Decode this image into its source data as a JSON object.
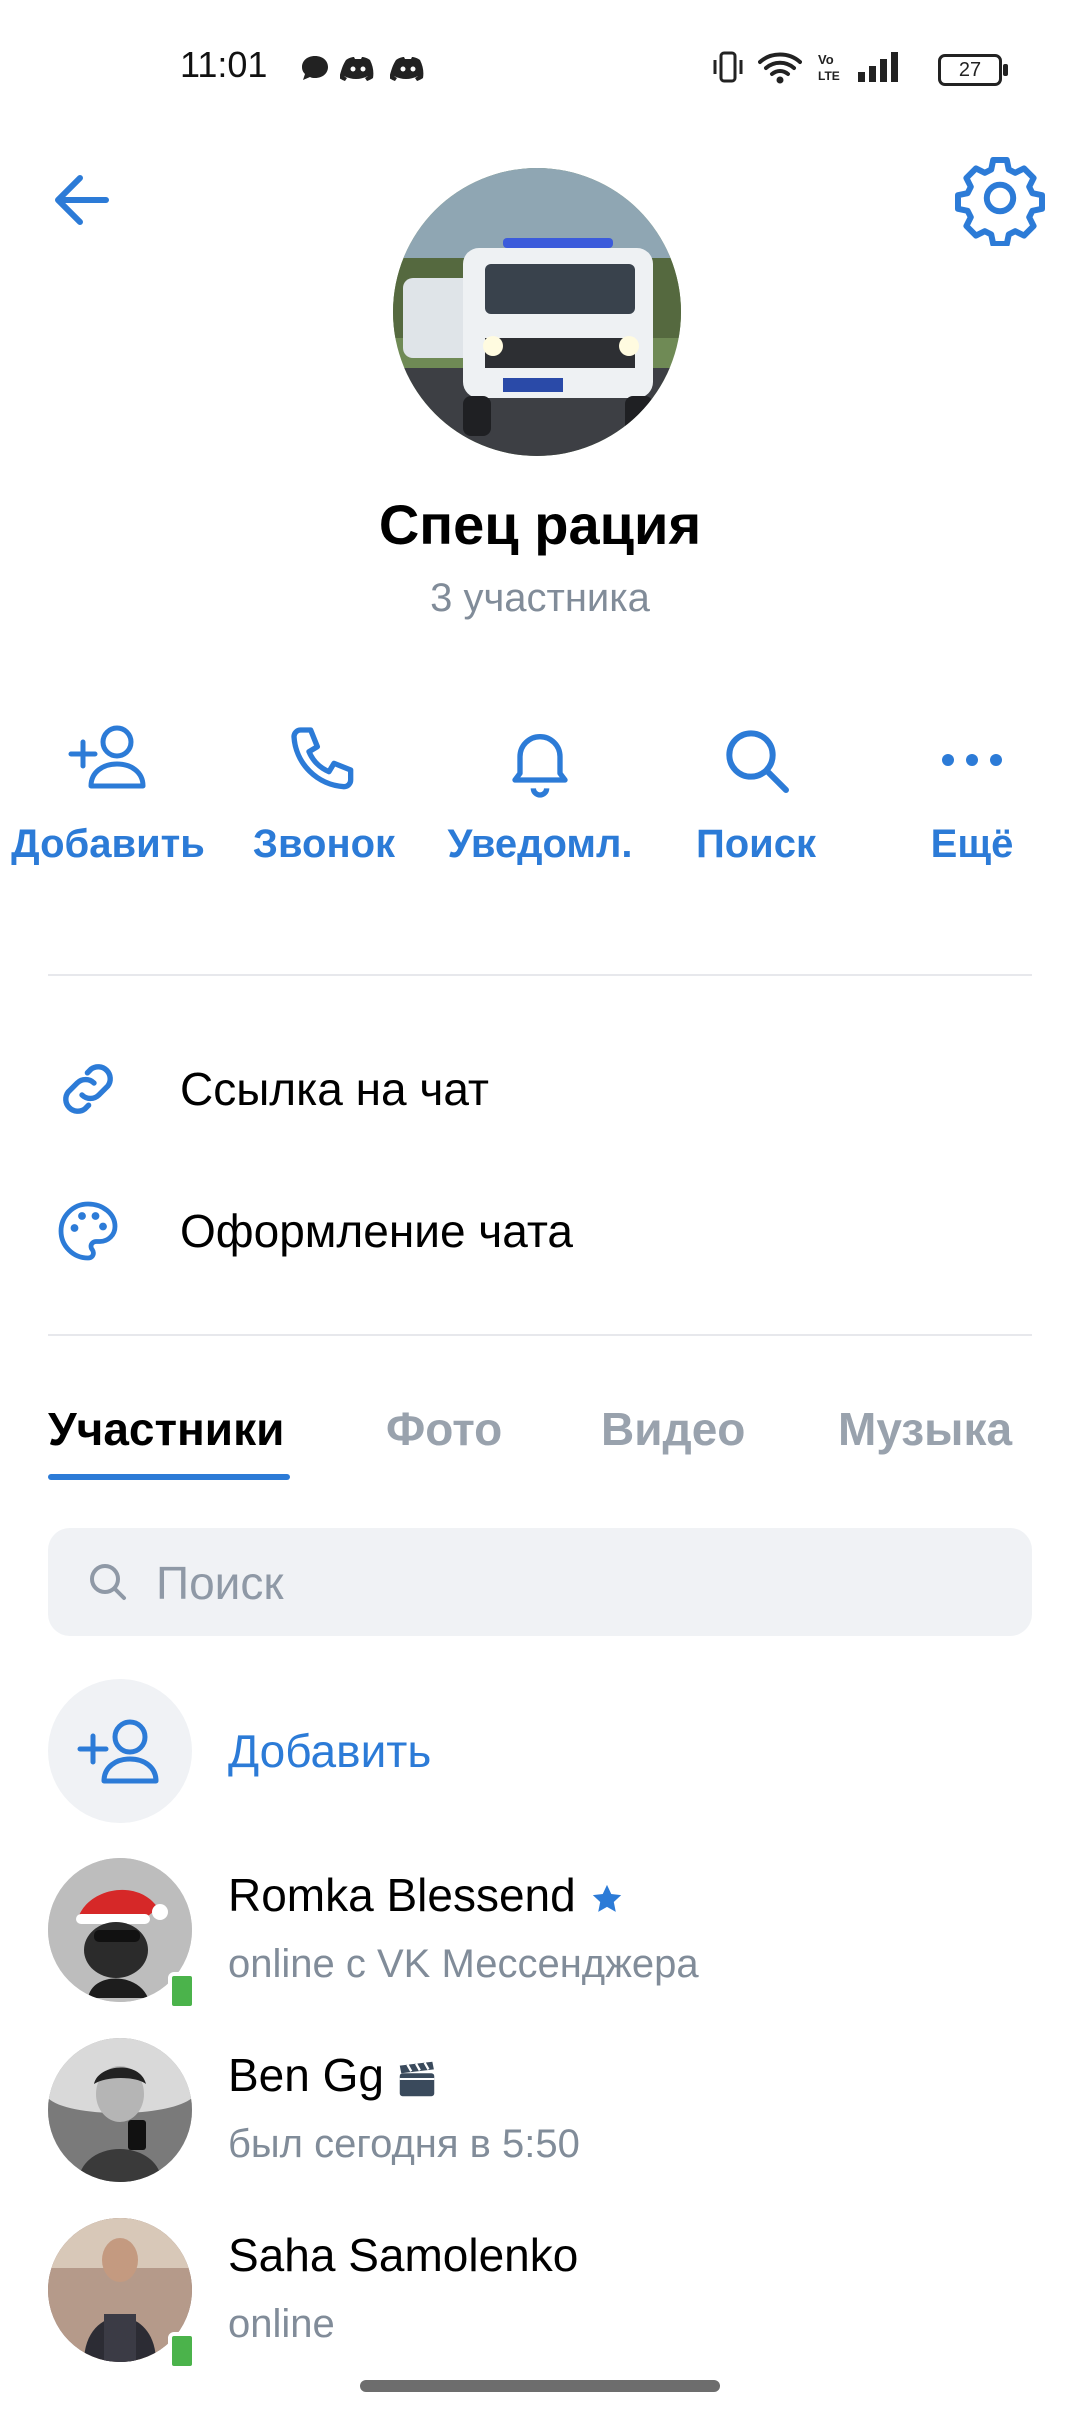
{
  "status_bar": {
    "time": "11:01",
    "battery": "27"
  },
  "header": {
    "title": "Спец рация",
    "subtitle": "3 участника"
  },
  "actions": [
    {
      "label": "Добавить",
      "icon": "add-user-icon"
    },
    {
      "label": "Звонок",
      "icon": "phone-icon"
    },
    {
      "label": "Уведомл.",
      "icon": "bell-icon"
    },
    {
      "label": "Поиск",
      "icon": "search-icon"
    },
    {
      "label": "Ещё",
      "icon": "more-icon"
    }
  ],
  "menu": [
    {
      "label": "Ссылка на чат",
      "icon": "link-icon"
    },
    {
      "label": "Оформление чата",
      "icon": "palette-icon"
    }
  ],
  "tabs": [
    {
      "label": "Участники",
      "active": true
    },
    {
      "label": "Фото",
      "active": false
    },
    {
      "label": "Видео",
      "active": false
    },
    {
      "label": "Музыка",
      "active": false
    }
  ],
  "search": {
    "placeholder": "Поиск"
  },
  "add_member": {
    "label": "Добавить"
  },
  "members": [
    {
      "name": "Romka Blessend",
      "status": "online с VK Мессенджера",
      "online": true,
      "badge": "star-icon"
    },
    {
      "name": "Ben Gg",
      "status": "был сегодня в 5:50",
      "online": false,
      "badge": "clapperboard-icon"
    },
    {
      "name": "Saha Samolenko",
      "status": "online",
      "online": true
    }
  ],
  "colors": {
    "accent": "#2c7bd7",
    "secondary_text": "#818c99",
    "online": "#4bb34b"
  }
}
